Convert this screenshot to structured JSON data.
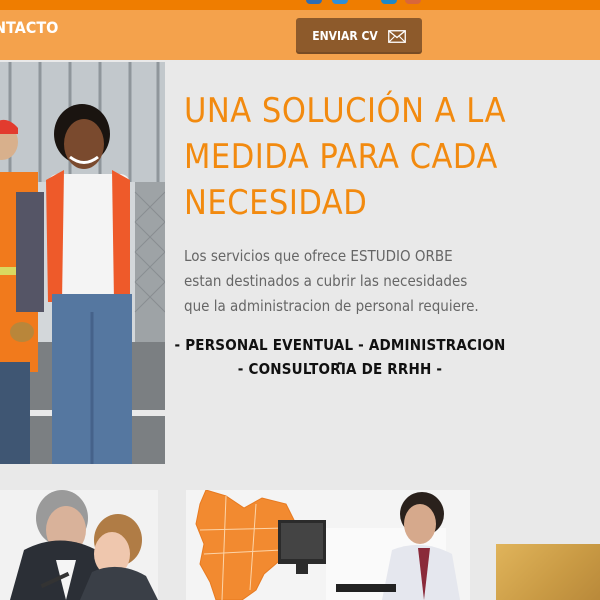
{
  "header": {
    "nav_label": "NTACTO",
    "cv_button_label": "ENVIAR CV"
  },
  "icons": {
    "cv": "envelope-icon",
    "social": [
      "social-icon-blue",
      "social-icon-blue",
      "social-icon-blue",
      "social-icon-orange"
    ]
  },
  "colors": {
    "brand_orange": "#ef7d00",
    "nav_bar": "#f4a24c",
    "cv_button": "#8d5a2b",
    "headline": "#f28a0f"
  },
  "main": {
    "headline_lines": [
      "UNA SOLUCIÓN A LA",
      "MEDIDA PARA CADA",
      "NECESIDAD"
    ],
    "description": "Los servicios que ofrece ESTUDIO ORBE estan destinados a cubrir las necesidades que la administracion de personal requiere.",
    "services_line1": "- PERSONAL EVENTUAL - ADMINISTRACION -",
    "services_line2": "- CONSULTORIA DE RRHH -"
  }
}
